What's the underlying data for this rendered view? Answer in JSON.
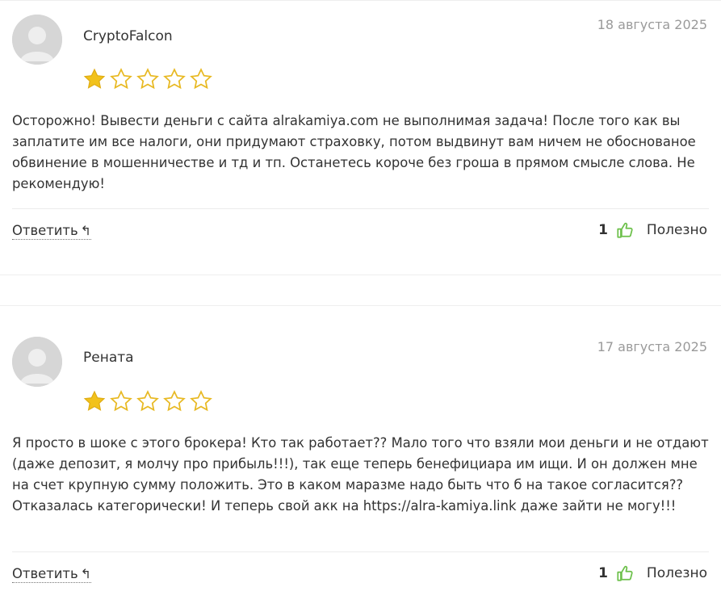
{
  "reviews": [
    {
      "author": "CryptoFalcon",
      "date": "18 августа 2025",
      "rating": 1,
      "max_rating": 5,
      "text": "Осторожно! Вывести деньги с сайта alrakamiya.com не выполнимая задача! После того как вы заплатите им все налоги, они придумают страховку, потом выдвинут вам ничем не обоснованое обвинение в мошенничестве и тд и тп. Останетесь короче без гроша в прямом смысле слова. Не рекомендую!",
      "reply_label": "Ответить",
      "reply_icon": "↰",
      "helpful_count": "1",
      "helpful_label": "Полезно"
    },
    {
      "author": "Рената",
      "date": "17 августа 2025",
      "rating": 1,
      "max_rating": 5,
      "text": "Я просто в шоке с этого брокера! Кто так работает?? Мало того что взяли мои деньги и не отдают (даже депозит, я молчу про прибыль!!!), так еще теперь бенефициара им ищи. И он должен мне на счет крупную сумму положить. Это в каком маразме надо быть что б на такое согласится?? Отказалась категорически! И теперь свой акк на https://alra-kamiya.link даже зайти не могу!!!",
      "reply_label": "Ответить",
      "reply_icon": "↰",
      "helpful_count": "1",
      "helpful_label": "Полезно"
    }
  ],
  "colors": {
    "star_filled": "#f2c21b",
    "star_outline": "#e8b923",
    "thumb": "#6cc04a",
    "date": "#9a9a9a",
    "avatar_bg": "#d9d9d9"
  },
  "icons": {
    "avatar": "user-silhouette",
    "star": "star-icon",
    "thumb": "thumbs-up-icon",
    "reply": "reply-arrow-icon"
  }
}
